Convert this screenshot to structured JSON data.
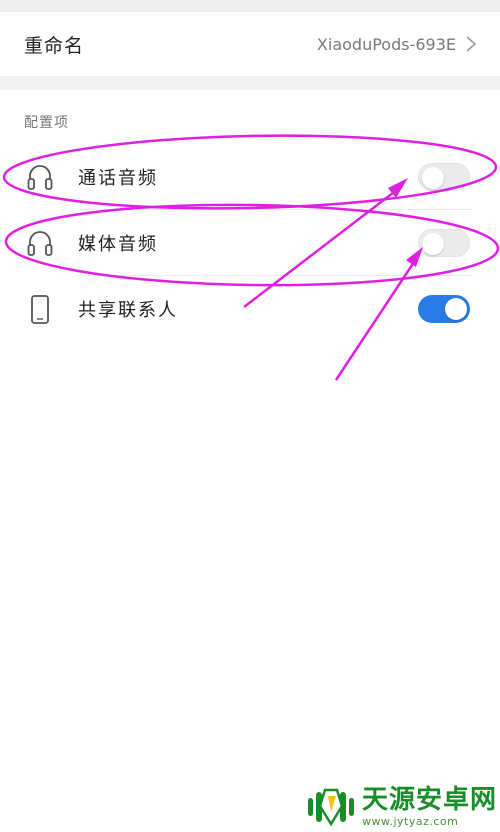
{
  "rename": {
    "label": "重命名",
    "value": "XiaoduPods-693E"
  },
  "config_section": {
    "title": "配置项",
    "items": [
      {
        "label": "通话音频",
        "icon": "headphones-icon",
        "enabled": false
      },
      {
        "label": "媒体音频",
        "icon": "headphones-icon",
        "enabled": false
      },
      {
        "label": "共享联系人",
        "icon": "phone-icon",
        "enabled": true
      }
    ]
  },
  "colors": {
    "accent": "#2a7be8",
    "annotation": "#e020e0",
    "watermark": "#1a8d2a"
  },
  "watermark": {
    "name": "天源安卓网",
    "url": "www.jytyaz.com"
  }
}
